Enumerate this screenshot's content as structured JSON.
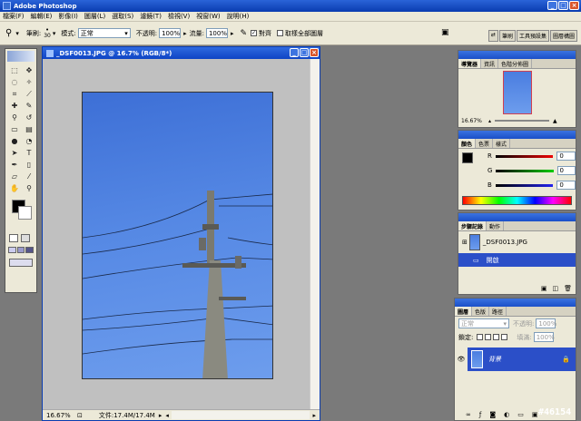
{
  "app": {
    "title": "Adobe Photoshop"
  },
  "menu": [
    "檔案(F)",
    "編輯(E)",
    "影像(I)",
    "圖層(L)",
    "選取(S)",
    "濾鏡(T)",
    "檢視(V)",
    "視窗(W)",
    "說明(H)"
  ],
  "options": {
    "brush_label": "筆刷:",
    "brush_size": "30",
    "mode_label": "模式:",
    "mode_value": "正常",
    "opacity_label": "不透明:",
    "opacity_value": "100%",
    "flow_label": "流量:",
    "flow_value": "100%",
    "aligned_label": "對齊",
    "sample_all_label": "取樣全部圖層",
    "palette_tabs": [
      "筆刷",
      "工具預設集",
      "圖層構圖"
    ]
  },
  "document": {
    "title": "_DSF0013.JPG @ 16.7% (RGB/8*)",
    "zoom": "16.67%",
    "status": "文件:17.4M/17.4M"
  },
  "navigator": {
    "tabs": [
      "導覽器",
      "資訊",
      "色階分佈圖"
    ],
    "zoom": "16.67%"
  },
  "color": {
    "tabs": [
      "顏色",
      "色票",
      "樣式"
    ],
    "channels": [
      {
        "name": "R",
        "value": "0",
        "color": "#d02020"
      },
      {
        "name": "G",
        "value": "0",
        "color": "#20b020"
      },
      {
        "name": "B",
        "value": "0",
        "color": "#2030c0"
      }
    ]
  },
  "history": {
    "tabs": [
      "步驟記錄",
      "動作"
    ],
    "items": [
      {
        "label": "_DSF0013.JPG"
      },
      {
        "label": "開啟"
      }
    ]
  },
  "layers": {
    "tabs": [
      "圖層",
      "色版",
      "路徑"
    ],
    "blend": "正常",
    "opacity_label": "不透明:",
    "opacity_value": "100%",
    "lock_label": "鎖定:",
    "fill_label": "填滿:",
    "fill_value": "100%",
    "layer_name": "背景"
  },
  "watermark": "#46154"
}
